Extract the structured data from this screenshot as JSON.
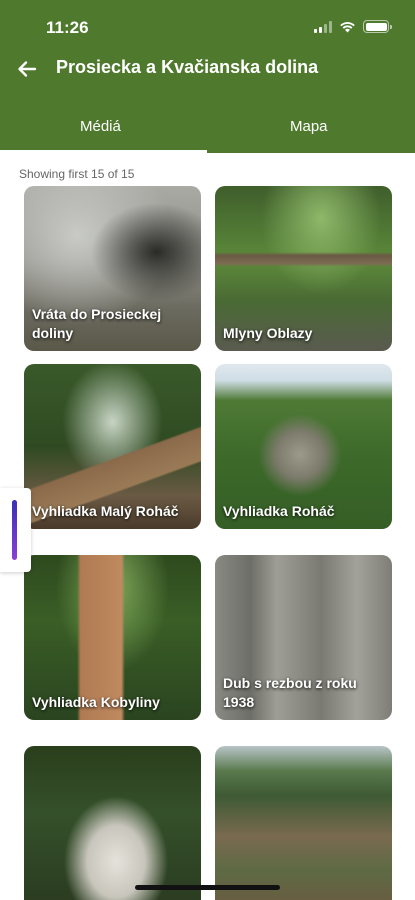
{
  "status_bar": {
    "time": "11:26"
  },
  "header": {
    "title": "Prosiecka a Kvačianska dolina"
  },
  "tabs": [
    {
      "label": "Médiá",
      "active": true
    },
    {
      "label": "Mapa",
      "active": false
    }
  ],
  "list_info": "Showing first 15 of 15",
  "tiles": [
    {
      "caption": "Vráta do Prosieckej doliny"
    },
    {
      "caption": "Mlyny Oblazy"
    },
    {
      "caption": "Vyhliadka Malý Roháč"
    },
    {
      "caption": "Vyhliadka Roháč"
    },
    {
      "caption": "Vyhliadka Kobyliny"
    },
    {
      "caption": "Dub s rezbou z roku 1938"
    },
    {
      "caption": ""
    },
    {
      "caption": ""
    }
  ],
  "colors": {
    "header_bg": "#4f7a2e",
    "text_on_header": "#ffffff"
  }
}
